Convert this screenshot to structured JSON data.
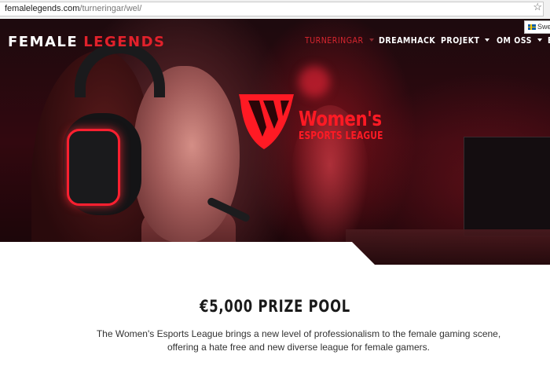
{
  "browser": {
    "url_domain": "femalelegends.com",
    "url_path": "/turneringar/wel/",
    "language_badge": "Swe"
  },
  "header": {
    "logo_part1": "FEMALE",
    "logo_part2": "LEGENDS",
    "nav": [
      {
        "label": "TURNERINGAR",
        "active": true,
        "dropdown": true
      },
      {
        "label": "DREAMHACK",
        "active": false,
        "dropdown": false
      },
      {
        "label": "PROJEKT",
        "active": false,
        "dropdown": true
      },
      {
        "label": "OM OSS",
        "active": false,
        "dropdown": true
      },
      {
        "label": "E",
        "active": false,
        "dropdown": false
      }
    ]
  },
  "hero": {
    "emblem_line1": "Women's",
    "emblem_line2": "ESPORTS LEAGUE"
  },
  "content": {
    "heading": "€5,000 PRIZE POOL",
    "description_line1": "The Women's Esports League brings a new level of professionalism to the female gaming scene,",
    "description_line2": "offering a hate free and new diverse league for female gamers."
  },
  "colors": {
    "brand_red": "#e2212b",
    "active_nav": "#d8262f",
    "emblem_red": "#ff1a24"
  },
  "icons": [
    "bookmark-star-icon",
    "swedish-flag-icon",
    "dropdown-caret-icon",
    "wel-logo-icon"
  ]
}
